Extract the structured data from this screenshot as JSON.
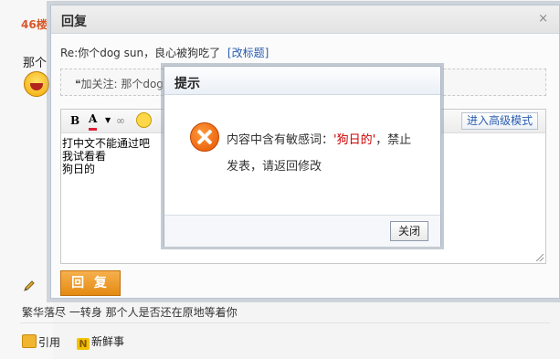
{
  "background": {
    "floor_label": "46楼",
    "post_text": "那个",
    "emoji": "laughing-face-icon",
    "bottom_line": "繁华落尽 一转身 那个人是否还在原地等着你",
    "actions": {
      "quote": "引用",
      "news": "新鲜事",
      "news_icon_letter": "N"
    }
  },
  "reply_dialog": {
    "title": "回复",
    "close_label": "×",
    "subject": "Re:你个dog sun，良心被狗吃了",
    "change_title": "[改标题]",
    "quote_text": "加关注: 那个dog",
    "quote_mark": "❝",
    "toolbar": {
      "bold": "B",
      "color": "A",
      "advanced_mode": "进入高级模式"
    },
    "editor_lines": [
      "打中文不能通过吧",
      "我试看看",
      "狗日的"
    ],
    "submit_label": "回 复"
  },
  "alert": {
    "title": "提示",
    "message_prefix": "内容中含有敏感词：",
    "keyword": "'狗日的'",
    "message_suffix": "，禁止发表，请返回修改",
    "close_button": "关闭"
  },
  "colors": {
    "accent_orange": "#e48a12",
    "link_blue": "#2a5db0",
    "keyword_red": "#cc0000"
  }
}
